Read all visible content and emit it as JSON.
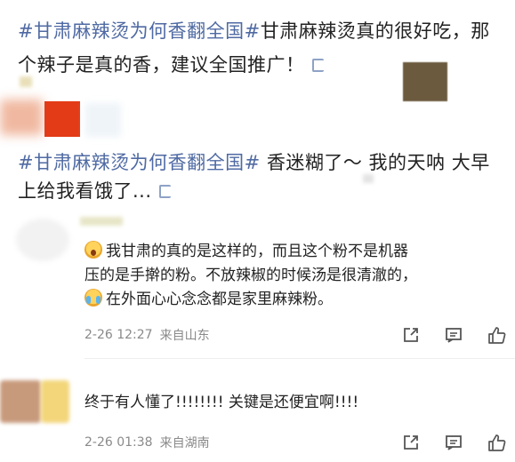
{
  "post1": {
    "tag": "#甘肃麻辣烫为何香翻全国#",
    "text_line1": "甘肃麻辣烫真的很好吃，那",
    "text_line2": "个辣子是真的香，建议全国推广！"
  },
  "post2": {
    "tag": "#甘肃麻辣烫为何香翻全国#",
    "text_line1": " 香迷糊了～ 我的天呐 大早",
    "text_line2": "上给我看饿了..."
  },
  "comments": [
    {
      "lines": [
        "我甘肃的真的是这样的，而且这个粉不是机器",
        "压的是手擀的粉。不放辣椒的时候汤是很清澈的，",
        "在外面心心念念都是家里麻辣粉。"
      ],
      "time": "2-26 12:27",
      "location": "来自山东"
    },
    {
      "lines": [
        "终于有人懂了!!!!!!!! 关键是还便宜啊!!!!"
      ],
      "time": "2-26 01:38",
      "location": "来自湖南"
    }
  ],
  "icons": [
    "link-icon",
    "share-icon",
    "comment-icon",
    "like-icon",
    "surprised-emoji-icon",
    "crying-emoji-icon"
  ],
  "colors": {
    "topic": "#4f6aa3",
    "meta": "#8a8a8a"
  }
}
